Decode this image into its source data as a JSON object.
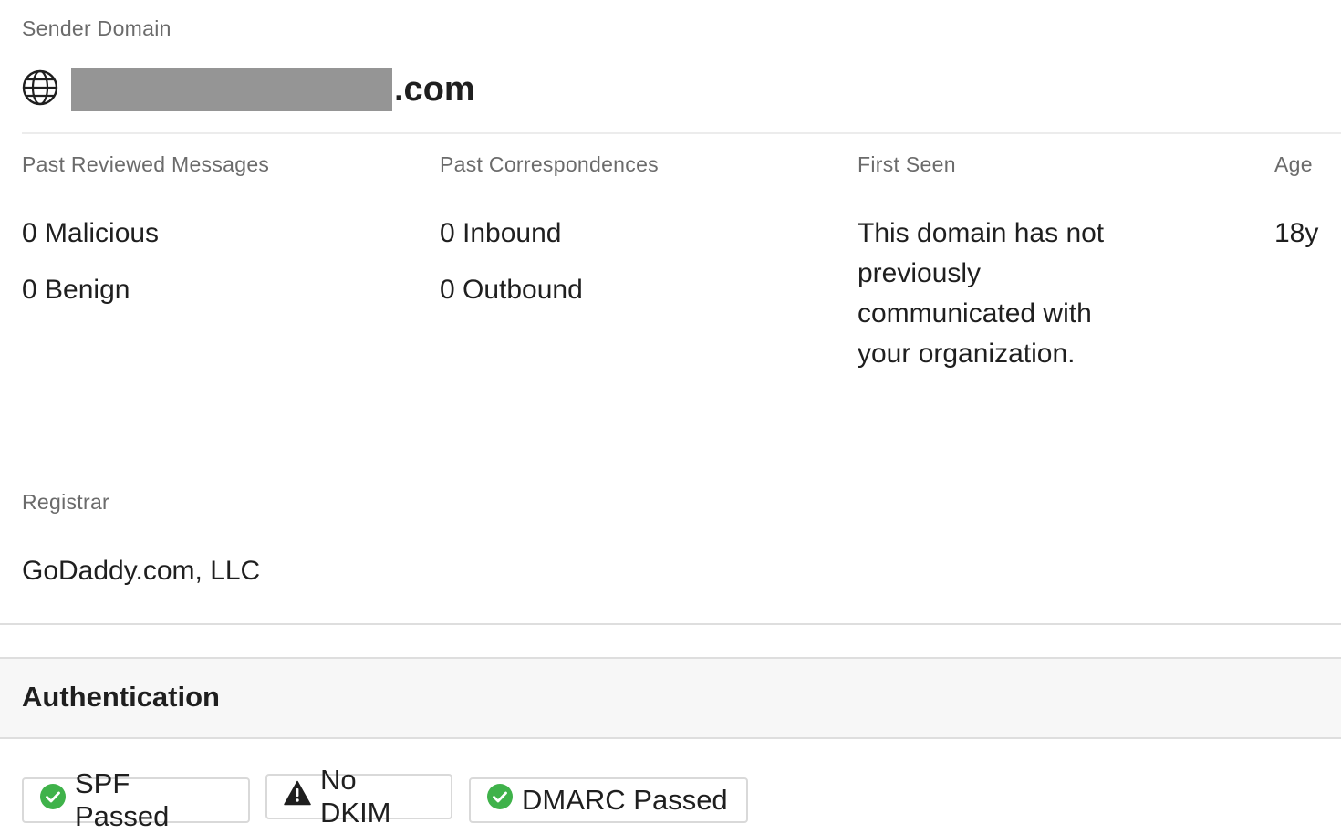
{
  "sender": {
    "label": "Sender Domain",
    "domain_suffix": ".com",
    "icon": "globe-icon"
  },
  "stats": {
    "reviewed": {
      "label": "Past Reviewed Messages",
      "malicious": "0 Malicious",
      "benign": "0 Benign"
    },
    "correspondences": {
      "label": "Past Correspondences",
      "inbound": "0 Inbound",
      "outbound": "0 Outbound"
    },
    "first_seen": {
      "label": "First Seen",
      "value": "This domain has not previously communicated with your organization."
    },
    "age": {
      "label": "Age",
      "value": "18y"
    }
  },
  "registrar": {
    "label": "Registrar",
    "value": "GoDaddy.com, LLC"
  },
  "authentication": {
    "title": "Authentication",
    "badges": [
      {
        "label": "SPF Passed",
        "status": "passed",
        "icon": "check-circle-icon",
        "color": "#3fb24a"
      },
      {
        "label": "No DKIM",
        "status": "warning",
        "icon": "warning-triangle-icon",
        "color": "#1f1f1f"
      },
      {
        "label": "DMARC Passed",
        "status": "passed",
        "icon": "check-circle-icon",
        "color": "#3fb24a"
      }
    ]
  }
}
